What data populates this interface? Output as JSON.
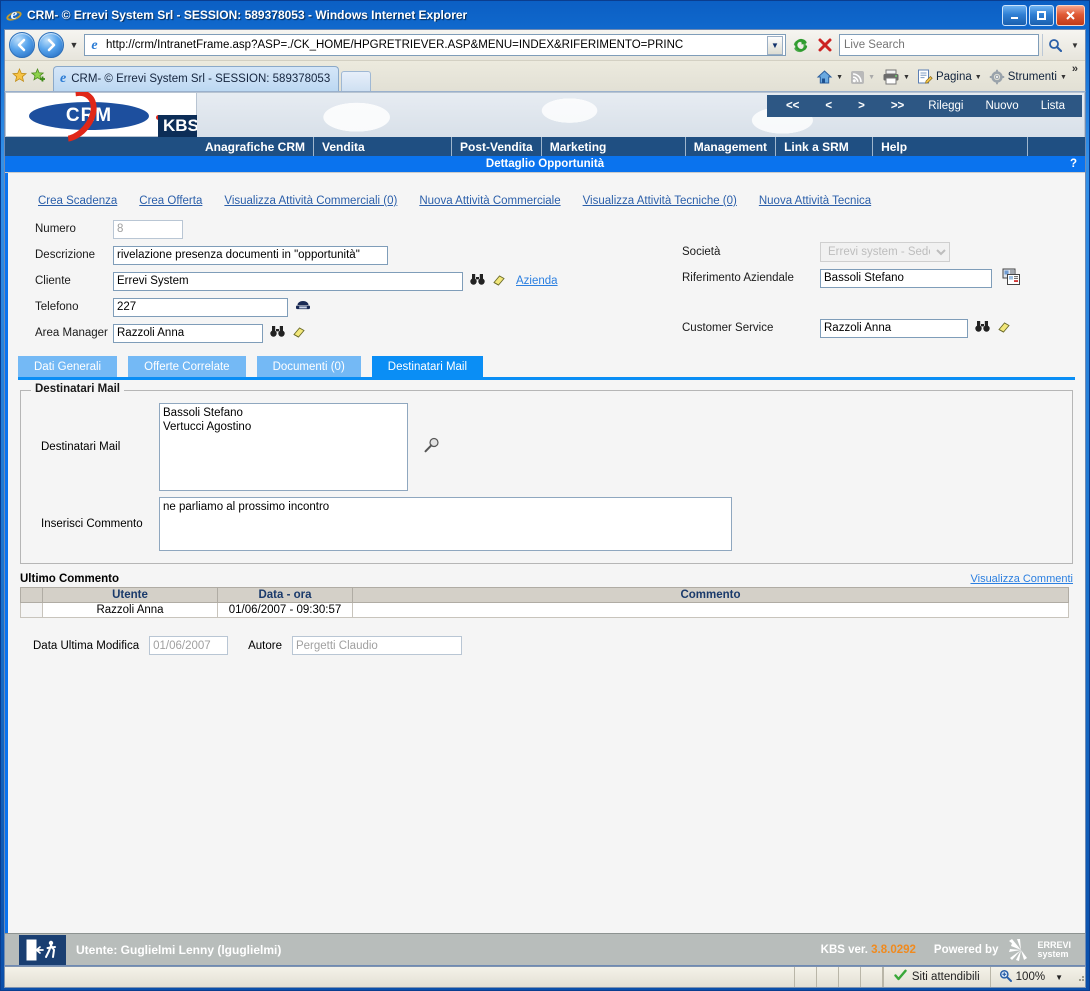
{
  "window": {
    "title": "CRM- © Errevi System Srl - SESSION: 589378053 - Windows Internet Explorer",
    "minimize_label": "Minimize",
    "maximize_label": "Maximize",
    "close_label": "Close"
  },
  "browser": {
    "back_label": "Back",
    "forward_label": "Forward",
    "recent_label": "Recent Pages",
    "url": "http://crm/IntranetFrame.asp?ASP=./CK_HOME/HPGRETRIEVER.ASP&MENU=INDEX&RIFERIMENTO=PRINC",
    "url_dropdown_icon": "chevron-down-icon",
    "refresh_icon": "refresh-icon",
    "stop_icon": "stop-icon",
    "search_placeholder": "Live Search",
    "search_value": "",
    "search_icon": "search-icon",
    "search_dropdown_icon": "chevron-down-icon",
    "favorites_icon": "favorites-star-icon",
    "add_favorites_icon": "add-favorites-icon",
    "tab_title": "CRM- © Errevi System Srl - SESSION: 589378053",
    "new_tab_label": "",
    "commands": [
      {
        "label": "",
        "icon": "home-icon",
        "caret": "▾"
      },
      {
        "label": "",
        "icon": "feeds-icon",
        "caret": "▾"
      },
      {
        "label": "",
        "icon": "print-icon",
        "caret": "▾"
      },
      {
        "label": "Pagina",
        "icon": "page-icon",
        "caret": "▾"
      },
      {
        "label": "Strumenti",
        "icon": "tools-gear-icon",
        "caret": "▾"
      }
    ],
    "overflow_label": "»"
  },
  "app": {
    "logo_text": "CRM",
    "kbs_badge": "KBS",
    "nav_buttons": [
      "<<",
      "<",
      ">",
      ">>",
      "Rileggi",
      "Nuovo",
      "Lista"
    ],
    "menu": [
      "Anagrafiche CRM",
      "Vendita",
      "Post-Vendita",
      "Marketing",
      "Management",
      "Link a SRM",
      "Help"
    ],
    "page_title": "Dettaglio Opportunità",
    "help_marker": "?"
  },
  "action_links": [
    "Crea Scadenza",
    "Crea Offerta",
    "Visualizza Attività Commerciali (0)",
    "Nuova Attività Commerciale",
    "Visualizza Attività Tecniche (0)",
    "Nuova Attività Tecnica"
  ],
  "form": {
    "left": {
      "numero_label": "Numero",
      "numero_value": "8",
      "descrizione_label": "Descrizione",
      "descrizione_value": "rivelazione presenza documenti in \"opportunità\"",
      "cliente_label": "Cliente",
      "cliente_value": "Errevi System",
      "cliente_link": "Azienda",
      "telefono_label": "Telefono",
      "telefono_value": "227",
      "area_manager_label": "Area Manager",
      "area_manager_value": "Razzoli Anna"
    },
    "right": {
      "societa_label": "Società",
      "societa_value": "Errevi system - Sede",
      "riferimento_label": "Riferimento Aziendale",
      "riferimento_value": "Bassoli Stefano",
      "customer_service_label": "Customer Service",
      "customer_service_value": "Razzoli Anna"
    }
  },
  "tabs": [
    {
      "label": "Dati Generali",
      "active": false
    },
    {
      "label": "Offerte Correlate",
      "active": false
    },
    {
      "label": "Documenti (0)",
      "active": false
    },
    {
      "label": "Destinatari Mail",
      "active": true
    }
  ],
  "panel": {
    "legend": "Destinatari Mail",
    "destinatari_label": "Destinatari Mail",
    "destinatari_value": "Bassoli Stefano\nVertucci Agostino",
    "commento_label": "Inserisci Commento",
    "commento_value": "ne parliamo al prossimo incontro"
  },
  "comments": {
    "section_title": "Ultimo Commento",
    "view_link": "Visualizza Commenti",
    "headers": [
      "",
      "Utente",
      "Data - ora",
      "Commento"
    ],
    "rows": [
      {
        "marker": "",
        "utente": "Razzoli Anna",
        "data_ora": "01/06/2007 - 09:30:57",
        "commento": ""
      }
    ]
  },
  "lastmod": {
    "date_label": "Data Ultima Modifica",
    "date_value": "01/06/2007",
    "author_label": "Autore",
    "author_value": "Pergetti Claudio"
  },
  "app_footer": {
    "exit_icon": "exit-door-icon",
    "user_text": "Utente: Guglielmi Lenny (lguglielmi)",
    "version_label": "KBS ver.",
    "version_number": "3.8.0292",
    "powered_by": "Powered by",
    "vendor_line1": "ERREVI",
    "vendor_line2": "system"
  },
  "status_bar": {
    "zone_icon": "check-shield-icon",
    "zone_text": "Siti attendibili",
    "zoom_icon": "zoom-icon",
    "zoom_level": "100%",
    "zoom_caret": "▾"
  },
  "colors": {
    "title_bar_blue": "#1673d6",
    "menu_navy": "#1f4f82",
    "title_band_blue": "#0a73ee",
    "tab_active": "#0a8ef5",
    "tab_inactive": "#74b9f5",
    "link_blue": "#2b5faa",
    "accent_orange": "#f08a1e",
    "footer_gray": "#b8bdbb"
  }
}
